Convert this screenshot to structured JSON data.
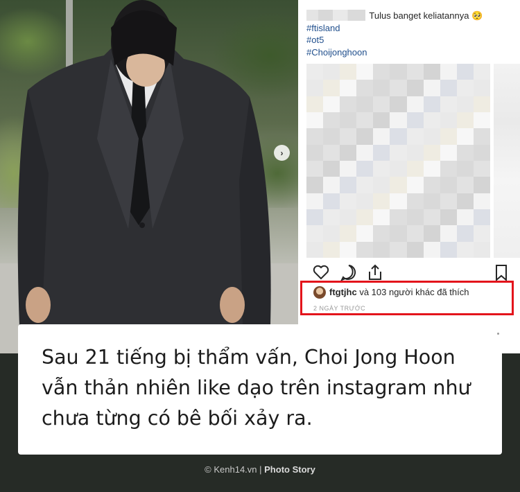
{
  "instagram": {
    "caption": "Tulus banget keliatannya 🥺",
    "hashtags": [
      "#ftisland",
      "#ot5",
      "#Choijonghoon"
    ],
    "likes": {
      "username": "ftgtjhc",
      "rest": " và 103 người khác đã thích"
    },
    "time_ago": "2 NGÀY TRƯỚC",
    "icons": [
      "heart-icon",
      "comment-icon",
      "share-icon",
      "bookmark-icon"
    ]
  },
  "carousel": {
    "arrow": "›"
  },
  "card": {
    "text": "Sau 21 tiếng bị thẩm vấn, Choi Jong Hoon vẫn thản nhiên like dạo trên instagram như chưa từng có bê bối xảy ra."
  },
  "footer": {
    "copyright": "© Kenh14.vn | ",
    "section": "Photo Story"
  },
  "colors": {
    "highlight_border": "#e3141b",
    "hashtag": "#1f4e8c",
    "background": "#262b26"
  }
}
